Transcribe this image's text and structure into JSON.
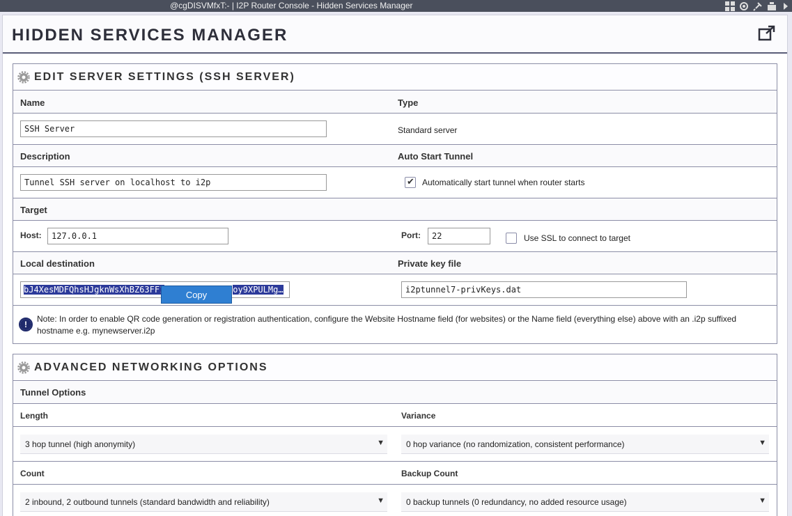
{
  "window": {
    "title": "@cgDISVMfxT:- | I2P Router Console - Hidden Services Manager"
  },
  "page": {
    "title": "HIDDEN SERVICES MANAGER"
  },
  "edit_panel": {
    "title": "EDIT SERVER SETTINGS (SSH SERVER)",
    "name_label": "Name",
    "name_value": "SSH Server",
    "type_label": "Type",
    "type_value": "Standard server",
    "description_label": "Description",
    "description_value": "Tunnel SSH server on localhost to i2p",
    "autostart_label": "Auto Start Tunnel",
    "autostart_text": "Automatically start tunnel when router starts",
    "autostart_checked": true,
    "target_label": "Target",
    "host_label": "Host:",
    "host_value": "127.0.0.1",
    "port_label": "Port:",
    "port_value": "22",
    "ssl_text": "Use SSL to connect to target",
    "ssl_checked": false,
    "local_dest_label": "Local destination",
    "local_dest_value": "bJ4XesMDFQhsHJgknWsXhBZ63FF1",
    "local_dest_tail": "oy9XPULMg…",
    "private_key_label": "Private key file",
    "private_key_value": "i2ptunnel7-privKeys.dat",
    "context_menu_copy": "Copy",
    "note": "Note: In order to enable QR code generation or registration authentication, configure the Website Hostname field (for websites) or the Name field (everything else) above with an .i2p suffixed hostname e.g. mynewserver.i2p"
  },
  "advanced_panel": {
    "title": "ADVANCED NETWORKING OPTIONS",
    "tunnel_options_label": "Tunnel Options",
    "length_label": "Length",
    "length_value": "3 hop tunnel (high anonymity)",
    "variance_label": "Variance",
    "variance_value": "0 hop variance (no randomization, consistent performance)",
    "count_label": "Count",
    "count_value": "2 inbound, 2 outbound tunnels (standard bandwidth and reliability)",
    "backup_label": "Backup Count",
    "backup_value": "0 backup tunnels (0 redundancy, no added resource usage)"
  },
  "colors": {
    "titlebar": "#4a4f5c",
    "border": "#8b8da6",
    "selection": "#2c3a9a",
    "copy_menu": "#2f7fd2"
  },
  "icons": [
    "grid-icon",
    "move-icon",
    "pin-icon",
    "window-icon",
    "arrow-right-icon",
    "external-link-icon",
    "gear-icon",
    "info-icon",
    "dropdown-arrow-icon"
  ]
}
